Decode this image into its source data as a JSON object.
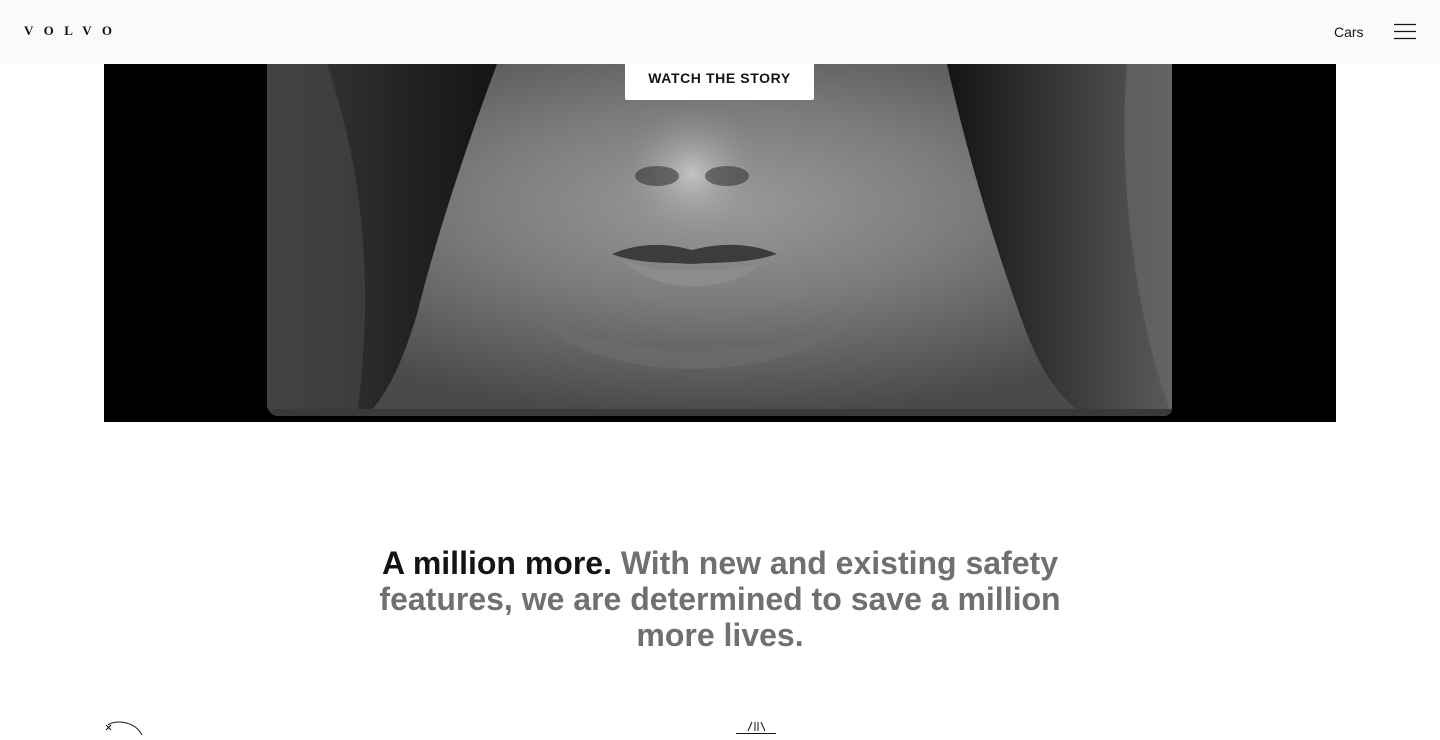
{
  "header": {
    "logo_text": "VOLVO",
    "nav_link": "Cars",
    "menu_icon": "hamburger-menu-icon"
  },
  "hero": {
    "button_label": "WATCH THE STORY"
  },
  "statement": {
    "lead": "A million more.",
    "rest": "With new and existing safety features, we are determined to save a million more lives."
  },
  "features": {
    "icons": [
      "circle-line-icon",
      "road-lanes-icon"
    ]
  },
  "colors": {
    "header_bg": "#fafafa",
    "text_primary": "#141414",
    "text_secondary": "#707070",
    "hero_bg": "#000000"
  }
}
